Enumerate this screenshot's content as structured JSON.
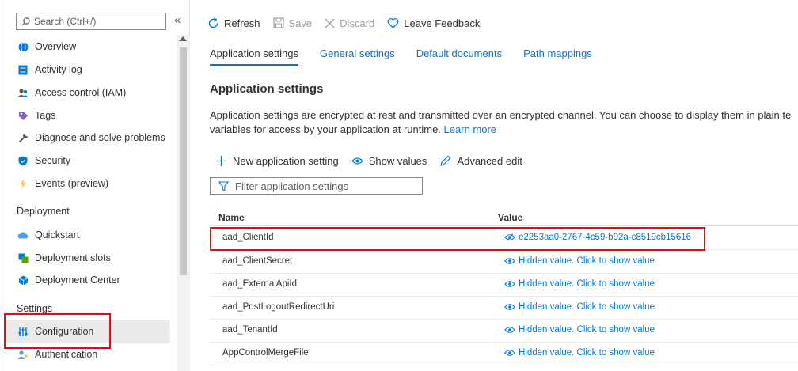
{
  "sidebar": {
    "search_placeholder": "Search (Ctrl+/)",
    "collapse_glyph": "«",
    "items": [
      {
        "label": "Overview",
        "icon": "globe-icon"
      },
      {
        "label": "Activity log",
        "icon": "activity-log-icon"
      },
      {
        "label": "Access control (IAM)",
        "icon": "people-icon"
      },
      {
        "label": "Tags",
        "icon": "tag-icon"
      },
      {
        "label": "Diagnose and solve problems",
        "icon": "wrench-icon"
      },
      {
        "label": "Security",
        "icon": "shield-icon"
      },
      {
        "label": "Events (preview)",
        "icon": "lightning-icon"
      }
    ],
    "deployment_header": "Deployment",
    "deployment_items": [
      {
        "label": "Quickstart",
        "icon": "cloud-icon"
      },
      {
        "label": "Deployment slots",
        "icon": "slots-icon"
      },
      {
        "label": "Deployment Center",
        "icon": "cube-icon"
      }
    ],
    "settings_header": "Settings",
    "settings_items": [
      {
        "label": "Configuration",
        "icon": "sliders-icon",
        "selected": true
      },
      {
        "label": "Authentication",
        "icon": "user-key-icon"
      }
    ]
  },
  "commandbar": {
    "refresh": "Refresh",
    "save": "Save",
    "discard": "Discard",
    "feedback": "Leave Feedback"
  },
  "tabs": [
    "Application settings",
    "General settings",
    "Default documents",
    "Path mappings"
  ],
  "page": {
    "title": "Application settings",
    "desc_line1": "Application settings are encrypted at rest and transmitted over an encrypted channel. You can choose to display them in plain te",
    "desc_line2": "variables for access by your application at runtime.",
    "learn_more": "Learn more"
  },
  "toolbar": {
    "new_setting": "New application setting",
    "show_values": "Show values",
    "advanced_edit": "Advanced edit",
    "filter_placeholder": "Filter application settings"
  },
  "table": {
    "headers": {
      "name": "Name",
      "value": "Value"
    },
    "rows": [
      {
        "name": "aad_ClientId",
        "value": "e2253aa0-2767-4c59-b92a-c8519cb15616"
      },
      {
        "name": "aad_ClientSecret",
        "value": "Hidden value. Click to show value"
      },
      {
        "name": "aad_ExternalApiId",
        "value": "Hidden value. Click to show value"
      },
      {
        "name": "aad_PostLogoutRedirectUri",
        "value": "Hidden value. Click to show value"
      },
      {
        "name": "aad_TenantId",
        "value": "Hidden value. Click to show value"
      },
      {
        "name": "AppControlMergeFile",
        "value": "Hidden value. Click to show value"
      }
    ]
  },
  "colors": {
    "accent": "#0078d4",
    "highlight": "#e00b1c"
  }
}
